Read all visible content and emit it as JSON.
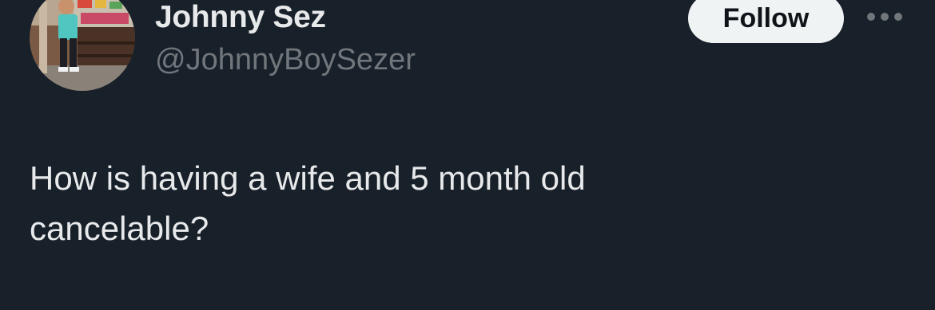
{
  "author": {
    "display_name": "Johnny Sez",
    "handle": "@JohnnyBoySezer"
  },
  "actions": {
    "follow_label": "Follow",
    "more_icon": "more-horizontal-icon"
  },
  "tweet": {
    "text": "How is having a wife and 5 month old\ncancelable?"
  },
  "colors": {
    "background": "#18202a",
    "primary_text": "#e7e9ea",
    "secondary_text": "#71767b",
    "follow_bg": "#eff3f4",
    "follow_text": "#0f1419"
  }
}
